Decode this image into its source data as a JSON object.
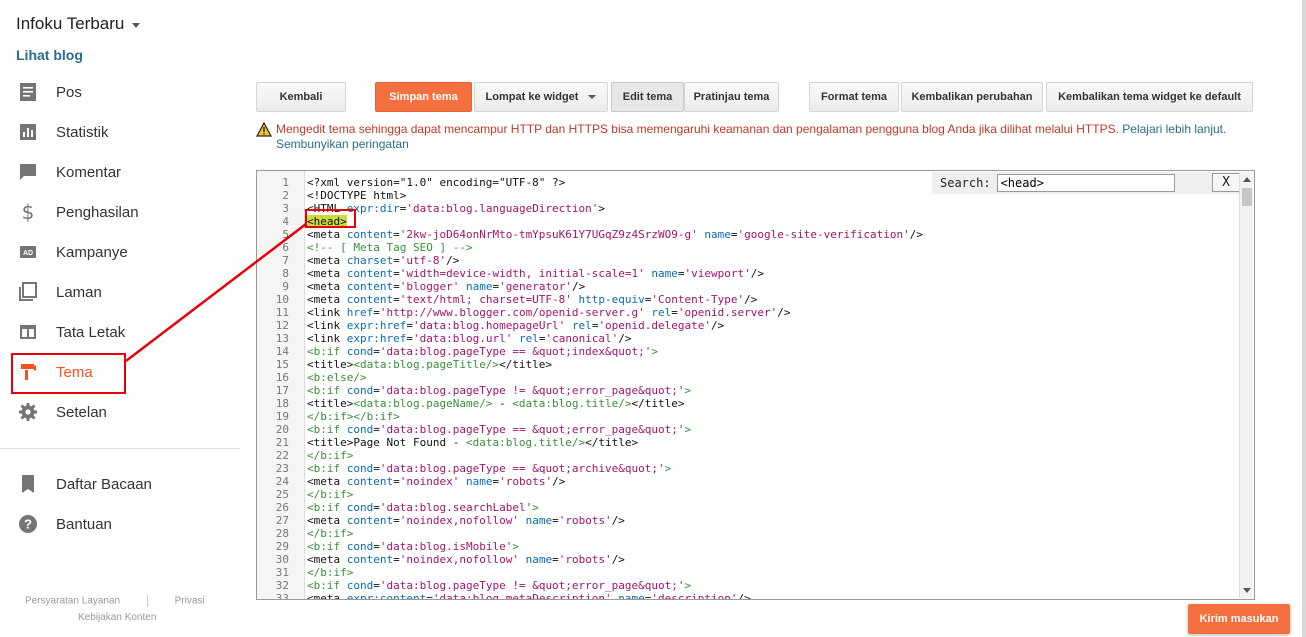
{
  "sidebar": {
    "blog_title": "Infoku Terbaru",
    "view_blog": "Lihat blog",
    "items": [
      {
        "label": "Pos",
        "icon": "posts-icon"
      },
      {
        "label": "Statistik",
        "icon": "stats-icon"
      },
      {
        "label": "Komentar",
        "icon": "comment-icon"
      },
      {
        "label": "Penghasilan",
        "icon": "dollar-icon"
      },
      {
        "label": "Kampanye",
        "icon": "ad-icon"
      },
      {
        "label": "Laman",
        "icon": "pages-icon"
      },
      {
        "label": "Tata Letak",
        "icon": "layout-icon"
      },
      {
        "label": "Tema",
        "icon": "paint-roller-icon",
        "active": true
      },
      {
        "label": "Setelan",
        "icon": "gear-icon"
      }
    ],
    "secondary": [
      {
        "label": "Daftar Bacaan",
        "icon": "bookmark-icon"
      },
      {
        "label": "Bantuan",
        "icon": "help-icon"
      }
    ],
    "footer": {
      "terms": "Persyaratan Layanan",
      "privacy": "Privasi",
      "content_policy": "Kebijakan Konten"
    }
  },
  "toolbar": {
    "back": "Kembali",
    "save": "Simpan tema",
    "jump": "Lompat ke widget",
    "edit": "Edit tema",
    "preview": "Pratinjau tema",
    "format": "Format tema",
    "revert": "Kembalikan perubahan",
    "revert_widgets": "Kembalikan tema widget ke default"
  },
  "warning": {
    "text": "Mengedit tema sehingga dapat mencampur HTTP dan HTTPS bisa memengaruhi keamanan dan pengalaman pengguna blog Anda jika dilihat melalui HTTPS.",
    "learn_more": "Pelajari lebih lanjut.",
    "hide": "Sembunyikan peringatan"
  },
  "search": {
    "label": "Search:",
    "value": "<head>",
    "close": "X"
  },
  "feedback": "Kirim masukan",
  "colors": {
    "accent": "#f4703e",
    "active_nav": "#f4511e",
    "annotation": "#e5000a",
    "link": "#2a6e8c"
  },
  "code_lines": [
    [
      [
        "t",
        "<?xml version=\"1.0\" encoding=\"UTF-8\" ?>"
      ]
    ],
    [
      [
        "t",
        "<!DOCTYPE html>"
      ]
    ],
    [
      [
        "t",
        "<HTML "
      ],
      [
        "a",
        "expr:dir"
      ],
      [
        "t",
        "="
      ],
      [
        "s",
        "'data:blog.languageDirection'"
      ],
      [
        "t",
        ">"
      ]
    ],
    [
      [
        "h",
        "<head>"
      ]
    ],
    [
      [
        "t",
        "<meta "
      ],
      [
        "a",
        "content"
      ],
      [
        "t",
        "="
      ],
      [
        "s",
        "'2kw-joD64onNrMto-tmYpsuK61Y7UGqZ9z4SrzWO9-g'"
      ],
      [
        "t",
        " "
      ],
      [
        "a",
        "name"
      ],
      [
        "t",
        "="
      ],
      [
        "s",
        "'google-site-verification'"
      ],
      [
        "t",
        "/>"
      ]
    ],
    [
      [
        "cm",
        "<!-- [ Meta Tag SEO ] -->"
      ]
    ],
    [
      [
        "t",
        "<meta "
      ],
      [
        "a",
        "charset"
      ],
      [
        "t",
        "="
      ],
      [
        "s",
        "'utf-8'"
      ],
      [
        "t",
        "/>"
      ]
    ],
    [
      [
        "t",
        "<meta "
      ],
      [
        "a",
        "content"
      ],
      [
        "t",
        "="
      ],
      [
        "s",
        "'width=device-width, initial-scale=1'"
      ],
      [
        "t",
        " "
      ],
      [
        "a",
        "name"
      ],
      [
        "t",
        "="
      ],
      [
        "s",
        "'viewport'"
      ],
      [
        "t",
        "/>"
      ]
    ],
    [
      [
        "t",
        "<meta "
      ],
      [
        "a",
        "content"
      ],
      [
        "t",
        "="
      ],
      [
        "s",
        "'blogger'"
      ],
      [
        "t",
        " "
      ],
      [
        "a",
        "name"
      ],
      [
        "t",
        "="
      ],
      [
        "s",
        "'generator'"
      ],
      [
        "t",
        "/>"
      ]
    ],
    [
      [
        "t",
        "<meta "
      ],
      [
        "a",
        "content"
      ],
      [
        "t",
        "="
      ],
      [
        "s",
        "'text/html; charset=UTF-8'"
      ],
      [
        "t",
        " "
      ],
      [
        "a",
        "http-equiv"
      ],
      [
        "t",
        "="
      ],
      [
        "s",
        "'Content-Type'"
      ],
      [
        "t",
        "/>"
      ]
    ],
    [
      [
        "t",
        "<link "
      ],
      [
        "a",
        "href"
      ],
      [
        "t",
        "="
      ],
      [
        "s",
        "'http://www.blogger.com/openid-server.g'"
      ],
      [
        "t",
        " "
      ],
      [
        "a",
        "rel"
      ],
      [
        "t",
        "="
      ],
      [
        "s",
        "'openid.server'"
      ],
      [
        "t",
        "/>"
      ]
    ],
    [
      [
        "t",
        "<link "
      ],
      [
        "a",
        "expr:href"
      ],
      [
        "t",
        "="
      ],
      [
        "s",
        "'data:blog.homepageUrl'"
      ],
      [
        "t",
        " "
      ],
      [
        "a",
        "rel"
      ],
      [
        "t",
        "="
      ],
      [
        "s",
        "'openid.delegate'"
      ],
      [
        "t",
        "/>"
      ]
    ],
    [
      [
        "t",
        "<link "
      ],
      [
        "a",
        "expr:href"
      ],
      [
        "t",
        "="
      ],
      [
        "s",
        "'data:blog.url'"
      ],
      [
        "t",
        " "
      ],
      [
        "a",
        "rel"
      ],
      [
        "t",
        "="
      ],
      [
        "s",
        "'canonical'"
      ],
      [
        "t",
        "/>"
      ]
    ],
    [
      [
        "b",
        "<b:if "
      ],
      [
        "a",
        "cond"
      ],
      [
        "t",
        "="
      ],
      [
        "s",
        "'data:blog.pageType == &quot;index&quot;'"
      ],
      [
        "b",
        ">"
      ]
    ],
    [
      [
        "t",
        "<title>"
      ],
      [
        "b",
        "<data:blog.pageTitle/>"
      ],
      [
        "t",
        "</title>"
      ]
    ],
    [
      [
        "b",
        "<b:else/>"
      ]
    ],
    [
      [
        "b",
        "<b:if "
      ],
      [
        "a",
        "cond"
      ],
      [
        "t",
        "="
      ],
      [
        "s",
        "'data:blog.pageType != &quot;error_page&quot;'"
      ],
      [
        "b",
        ">"
      ]
    ],
    [
      [
        "t",
        "<title>"
      ],
      [
        "b",
        "<data:blog.pageName/>"
      ],
      [
        "t",
        " - "
      ],
      [
        "b",
        "<data:blog.title/>"
      ],
      [
        "t",
        "</title>"
      ]
    ],
    [
      [
        "b",
        "</b:if></b:if>"
      ]
    ],
    [
      [
        "b",
        "<b:if "
      ],
      [
        "a",
        "cond"
      ],
      [
        "t",
        "="
      ],
      [
        "s",
        "'data:blog.pageType == &quot;error_page&quot;'"
      ],
      [
        "b",
        ">"
      ]
    ],
    [
      [
        "t",
        "<title>Page Not Found - "
      ],
      [
        "b",
        "<data:blog.title/>"
      ],
      [
        "t",
        "</title>"
      ]
    ],
    [
      [
        "b",
        "</b:if>"
      ]
    ],
    [
      [
        "b",
        "<b:if "
      ],
      [
        "a",
        "cond"
      ],
      [
        "t",
        "="
      ],
      [
        "s",
        "'data:blog.pageType == &quot;archive&quot;'"
      ],
      [
        "b",
        ">"
      ]
    ],
    [
      [
        "t",
        "<meta "
      ],
      [
        "a",
        "content"
      ],
      [
        "t",
        "="
      ],
      [
        "s",
        "'noindex'"
      ],
      [
        "t",
        " "
      ],
      [
        "a",
        "name"
      ],
      [
        "t",
        "="
      ],
      [
        "s",
        "'robots'"
      ],
      [
        "t",
        "/>"
      ]
    ],
    [
      [
        "b",
        "</b:if>"
      ]
    ],
    [
      [
        "b",
        "<b:if "
      ],
      [
        "a",
        "cond"
      ],
      [
        "t",
        "="
      ],
      [
        "s",
        "'data:blog.searchLabel'"
      ],
      [
        "b",
        ">"
      ]
    ],
    [
      [
        "t",
        "<meta "
      ],
      [
        "a",
        "content"
      ],
      [
        "t",
        "="
      ],
      [
        "s",
        "'noindex,nofollow'"
      ],
      [
        "t",
        " "
      ],
      [
        "a",
        "name"
      ],
      [
        "t",
        "="
      ],
      [
        "s",
        "'robots'"
      ],
      [
        "t",
        "/>"
      ]
    ],
    [
      [
        "b",
        "</b:if>"
      ]
    ],
    [
      [
        "b",
        "<b:if "
      ],
      [
        "a",
        "cond"
      ],
      [
        "t",
        "="
      ],
      [
        "s",
        "'data:blog.isMobile'"
      ],
      [
        "b",
        ">"
      ]
    ],
    [
      [
        "t",
        "<meta "
      ],
      [
        "a",
        "content"
      ],
      [
        "t",
        "="
      ],
      [
        "s",
        "'noindex,nofollow'"
      ],
      [
        "t",
        " "
      ],
      [
        "a",
        "name"
      ],
      [
        "t",
        "="
      ],
      [
        "s",
        "'robots'"
      ],
      [
        "t",
        "/>"
      ]
    ],
    [
      [
        "b",
        "</b:if>"
      ]
    ],
    [
      [
        "b",
        "<b:if "
      ],
      [
        "a",
        "cond"
      ],
      [
        "t",
        "="
      ],
      [
        "s",
        "'data:blog.pageType != &quot;error_page&quot;'"
      ],
      [
        "b",
        ">"
      ]
    ],
    [
      [
        "t",
        "<meta "
      ],
      [
        "a",
        "expr:content"
      ],
      [
        "t",
        "="
      ],
      [
        "s",
        "'data:blog.metaDescription'"
      ],
      [
        "t",
        " "
      ],
      [
        "a",
        "name"
      ],
      [
        "t",
        "="
      ],
      [
        "s",
        "'description'"
      ],
      [
        "t",
        "/>"
      ]
    ]
  ]
}
